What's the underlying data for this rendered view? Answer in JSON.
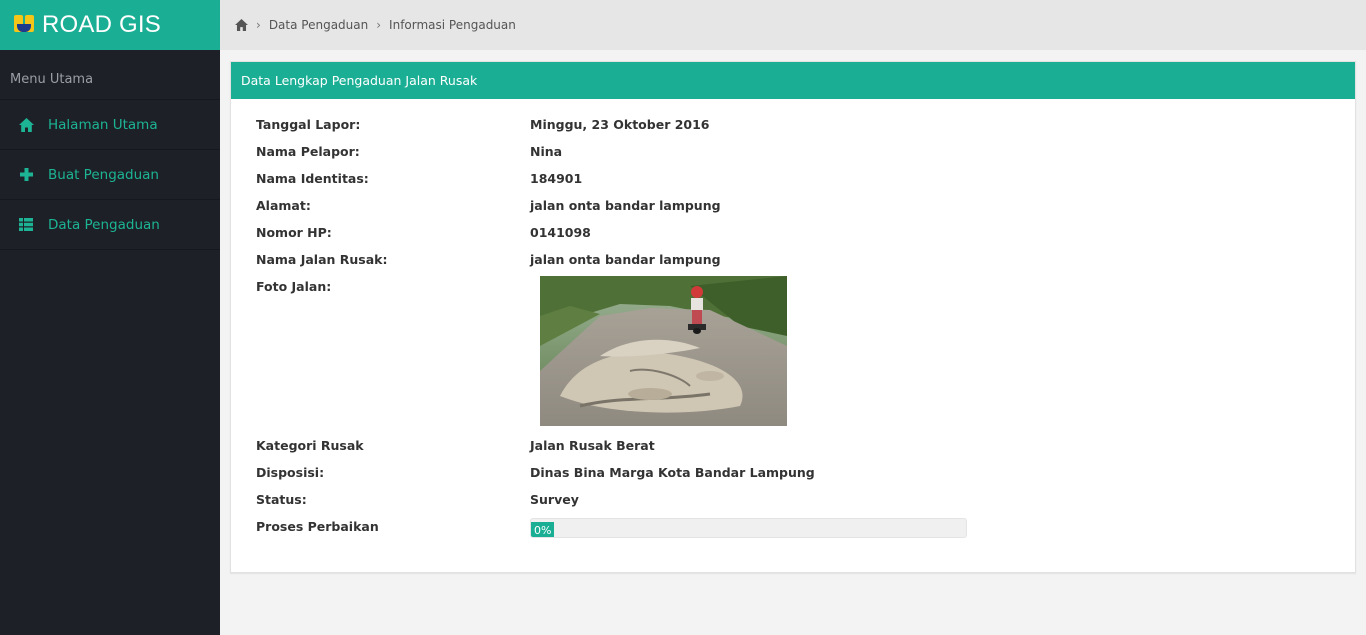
{
  "app": {
    "title": "ROAD GIS"
  },
  "sidebar": {
    "menu_header": "Menu Utama",
    "items": [
      {
        "label": "Halaman Utama",
        "icon": "home-icon"
      },
      {
        "label": "Buat Pengaduan",
        "icon": "plus-icon"
      },
      {
        "label": "Data Pengaduan",
        "icon": "list-icon"
      }
    ]
  },
  "breadcrumb": {
    "home_icon": "home-icon",
    "items": [
      "Data Pengaduan",
      "Informasi Pengaduan"
    ]
  },
  "panel": {
    "title": "Data Lengkap Pengaduan Jalan Rusak",
    "fields": {
      "tanggal": {
        "label": "Tanggal Lapor:",
        "value": "Minggu, 23 Oktober 2016"
      },
      "pelapor": {
        "label": "Nama Pelapor:",
        "value": "Nina"
      },
      "identitas": {
        "label": "Nama Identitas:",
        "value": "184901"
      },
      "alamat": {
        "label": "Alamat:",
        "value": "jalan onta bandar lampung"
      },
      "hp": {
        "label": "Nomor HP:",
        "value": "0141098"
      },
      "jalan": {
        "label": "Nama Jalan Rusak:",
        "value": "jalan onta bandar lampung"
      },
      "foto": {
        "label": "Foto Jalan:"
      },
      "kategori": {
        "label": "Kategori Rusak",
        "value": "Jalan Rusak Berat"
      },
      "disposisi": {
        "label": "Disposisi:",
        "value": "Dinas Bina Marga Kota Bandar Lampung"
      },
      "status": {
        "label": "Status:",
        "value": "Survey"
      },
      "proses": {
        "label": "Proses Perbaikan",
        "progress_text": "0%",
        "progress_value": 0
      }
    }
  },
  "colors": {
    "accent": "#1aaf95",
    "sidebar_bg": "#1e2027",
    "topbar_bg": "#e6e6e6"
  }
}
